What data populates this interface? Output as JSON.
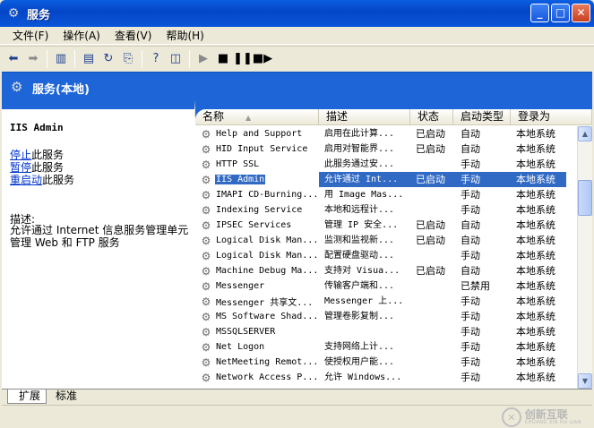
{
  "window": {
    "title": "服务",
    "minimize": "_",
    "maximize": "□",
    "close": "✕"
  },
  "menu": [
    "文件(F)",
    "操作(A)",
    "查看(V)",
    "帮助(H)"
  ],
  "header": {
    "title": "服务(本地)"
  },
  "left_pane": {
    "service_name": "IIS Admin",
    "actions": [
      {
        "link": "停止",
        "suffix": "此服务"
      },
      {
        "link": "暂停",
        "suffix": "此服务"
      },
      {
        "link": "重启动",
        "suffix": "此服务"
      }
    ],
    "description_label": "描述:",
    "description": "允许通过 Internet 信息服务管理单元管理 Web 和 FTP 服务"
  },
  "columns": [
    "名称",
    "描述",
    "状态",
    "启动类型",
    "登录为"
  ],
  "sort_indicator": "▲",
  "rows": [
    {
      "name": "Help and Support",
      "desc": "启用在此计算...",
      "status": "已启动",
      "start": "自动",
      "logon": "本地系统"
    },
    {
      "name": "HID Input Service",
      "desc": "启用对智能界...",
      "status": "已启动",
      "start": "自动",
      "logon": "本地系统"
    },
    {
      "name": "HTTP SSL",
      "desc": "此服务通过安...",
      "status": "",
      "start": "手动",
      "logon": "本地系统"
    },
    {
      "name": "IIS Admin",
      "desc": "允许通过 Int...",
      "status": "已启动",
      "start": "手动",
      "logon": "本地系统",
      "selected": true
    },
    {
      "name": "IMAPI CD-Burning...",
      "desc": "用 Image Mas...",
      "status": "",
      "start": "手动",
      "logon": "本地系统"
    },
    {
      "name": "Indexing Service",
      "desc": "本地和远程计...",
      "status": "",
      "start": "手动",
      "logon": "本地系统"
    },
    {
      "name": "IPSEC Services",
      "desc": "管理 IP 安全...",
      "status": "已启动",
      "start": "自动",
      "logon": "本地系统"
    },
    {
      "name": "Logical Disk Man...",
      "desc": "监测和监视新...",
      "status": "已启动",
      "start": "自动",
      "logon": "本地系统"
    },
    {
      "name": "Logical Disk Man...",
      "desc": "配置硬盘驱动...",
      "status": "",
      "start": "手动",
      "logon": "本地系统"
    },
    {
      "name": "Machine Debug Ma...",
      "desc": "支持对 Visua...",
      "status": "已启动",
      "start": "自动",
      "logon": "本地系统"
    },
    {
      "name": "Messenger",
      "desc": "传输客户端和...",
      "status": "",
      "start": "已禁用",
      "logon": "本地系统"
    },
    {
      "name": "Messenger 共享文...",
      "desc": "Messenger 上...",
      "status": "",
      "start": "手动",
      "logon": "本地系统"
    },
    {
      "name": "MS Software Shad...",
      "desc": "管理卷影复制...",
      "status": "",
      "start": "手动",
      "logon": "本地系统"
    },
    {
      "name": "MSSQLSERVER",
      "desc": "",
      "status": "",
      "start": "手动",
      "logon": "本地系统"
    },
    {
      "name": "Net Logon",
      "desc": "支持网络上计...",
      "status": "",
      "start": "手动",
      "logon": "本地系统"
    },
    {
      "name": "NetMeeting Remot...",
      "desc": "使授权用户能...",
      "status": "",
      "start": "手动",
      "logon": "本地系统"
    },
    {
      "name": "Network Access P...",
      "desc": "允许 Windows...",
      "status": "",
      "start": "手动",
      "logon": "本地系统"
    }
  ],
  "tabs": [
    "扩展",
    "标准"
  ],
  "watermark": {
    "text": "创新互联",
    "sub": "CHUANG XIN HU LIAN"
  },
  "icons": {
    "app": "gear-icon",
    "toolbar": [
      "back-arrow-icon",
      "forward-arrow-icon",
      "console-tree-icon",
      "properties-icon",
      "refresh-icon",
      "export-list-icon",
      "help-icon",
      "toggle-pane-icon",
      "start-service-icon",
      "stop-service-icon",
      "pause-service-icon",
      "restart-service-icon"
    ]
  }
}
